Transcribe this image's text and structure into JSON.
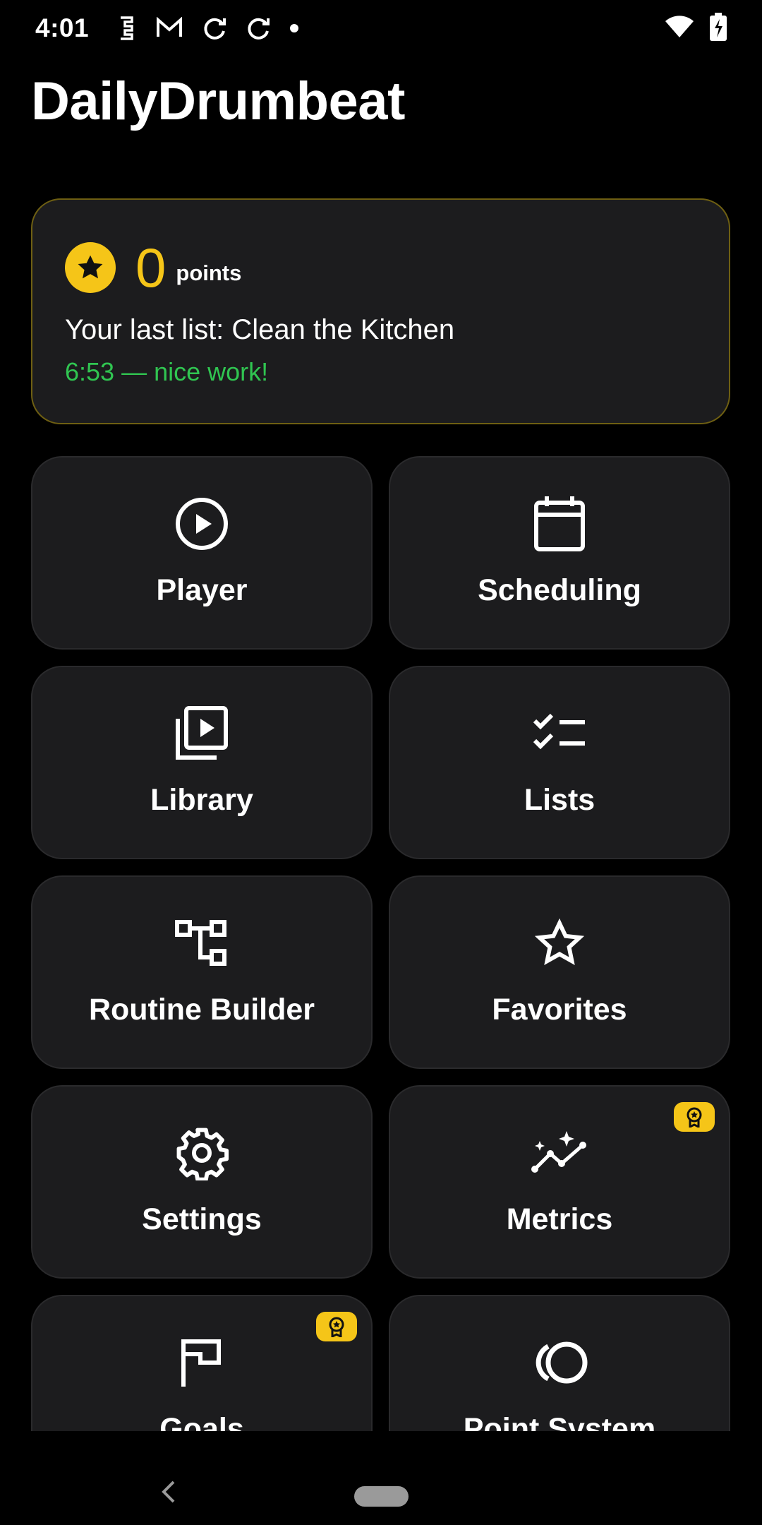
{
  "status_bar": {
    "time": "4:01",
    "notification_icons": [
      "sim-icon",
      "gmail-icon",
      "sync-icon",
      "sync-icon",
      "dot-icon"
    ],
    "wifi_icon": "wifi-icon",
    "battery_icon": "battery-charging-icon"
  },
  "app": {
    "title": "DailyDrumbeat"
  },
  "points_card": {
    "value": "0",
    "unit": "points",
    "last_list": "Your last list: Clean the Kitchen",
    "last_time": "6:53 — nice work!",
    "accent_color": "#f5c518",
    "success_color": "#30c551"
  },
  "tiles": [
    {
      "label": "Player",
      "icon": "play-circle-icon"
    },
    {
      "label": "Scheduling",
      "icon": "calendar-icon"
    },
    {
      "label": "Library",
      "icon": "video-library-icon"
    },
    {
      "label": "Lists",
      "icon": "checklist-icon"
    },
    {
      "label": "Routine Builder",
      "icon": "tree-structure-icon"
    },
    {
      "label": "Favorites",
      "icon": "star-outline-icon"
    },
    {
      "label": "Settings",
      "icon": "gear-icon"
    },
    {
      "label": "Metrics",
      "icon": "sparkle-chart-icon",
      "pro": true
    },
    {
      "label": "Goals",
      "icon": "flag-icon",
      "pro": true
    },
    {
      "label": "Point System",
      "icon": "circles-icon"
    }
  ],
  "nav": {
    "back_icon": "back-chevron-icon",
    "home_icon": "home-pill-icon"
  }
}
